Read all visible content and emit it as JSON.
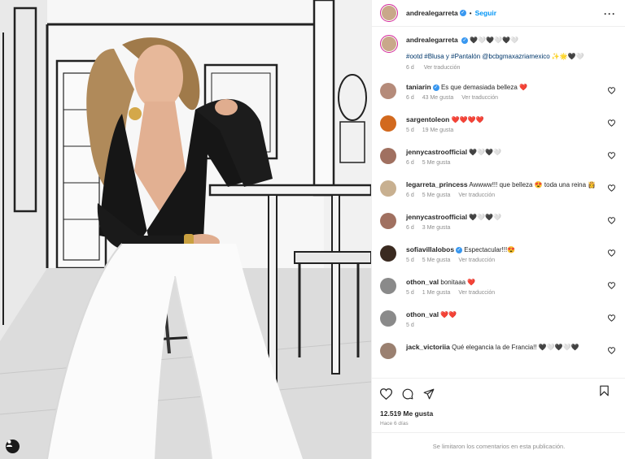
{
  "post": {
    "author": "andrealegarreta",
    "follow_label": "Seguir",
    "caption_emojis": "🖤🤍🖤🤍🖤🤍",
    "caption_tags": "#ootd #Blusa y #Pantalón @bcbgmaxazriamexico",
    "caption_tail": "✨🌟🖤🤍",
    "caption_age": "6 d",
    "caption_translate": "Ver traducción",
    "likes": "12.519 Me gusta",
    "posted_ago": "Hace 6 días",
    "comments_limited": "Se limitaron los comentarios en esta publicación."
  },
  "comments": [
    {
      "user": "taniarin",
      "verified": true,
      "text": "Es que demasiada belleza ❤️",
      "age": "6 d",
      "likes": "43 Me gusta",
      "translate": "Ver traducción",
      "avatar_color": "#b58b7a"
    },
    {
      "user": "sargentoleon",
      "verified": false,
      "text": "❤️❤️❤️❤️",
      "age": "5 d",
      "likes": "19 Me gusta",
      "translate": "",
      "avatar_color": "#d2691e"
    },
    {
      "user": "jennycastroofficial",
      "verified": false,
      "text": "🖤🤍🖤🤍",
      "age": "6 d",
      "likes": "5 Me gusta",
      "translate": "",
      "avatar_color": "#a07060"
    },
    {
      "user": "legarreta_princess",
      "verified": false,
      "text": "Awwww!!! que belleza 😍 toda una reina 👸",
      "age": "6 d",
      "likes": "5 Me gusta",
      "translate": "Ver traducción",
      "avatar_color": "#c8b090"
    },
    {
      "user": "jennycastroofficial",
      "verified": false,
      "text": "🖤🤍🖤🤍",
      "age": "6 d",
      "likes": "3 Me gusta",
      "translate": "",
      "avatar_color": "#a07060"
    },
    {
      "user": "sofiavillalobos",
      "verified": true,
      "text": "Espectacular!!!😍",
      "age": "5 d",
      "likes": "5 Me gusta",
      "translate": "Ver traducción",
      "avatar_color": "#3a2a20"
    },
    {
      "user": "othon_val",
      "verified": false,
      "text": "bonitaaa ❤️",
      "age": "5 d",
      "likes": "1 Me gusta",
      "translate": "Ver traducción",
      "avatar_color": "#8a8a8a"
    },
    {
      "user": "othon_val",
      "verified": false,
      "text": "❤️❤️",
      "age": "5 d",
      "likes": "",
      "translate": "",
      "avatar_color": "#8a8a8a"
    },
    {
      "user": "jack_victoriia",
      "verified": false,
      "text": "Qué elegancia la de Francia!! 🖤🤍🖤🤍🖤",
      "age": "",
      "likes": "",
      "translate": "",
      "avatar_color": "#9a8070"
    }
  ],
  "colors": {
    "accent": "#0095f6",
    "verified": "#3897f0",
    "story_ring": "#d6249f",
    "heart": "#e0245e"
  },
  "icons": [
    "heart-icon",
    "comment-icon",
    "share-icon",
    "bookmark-icon",
    "more-icon",
    "tag-user-icon",
    "verified-icon"
  ]
}
